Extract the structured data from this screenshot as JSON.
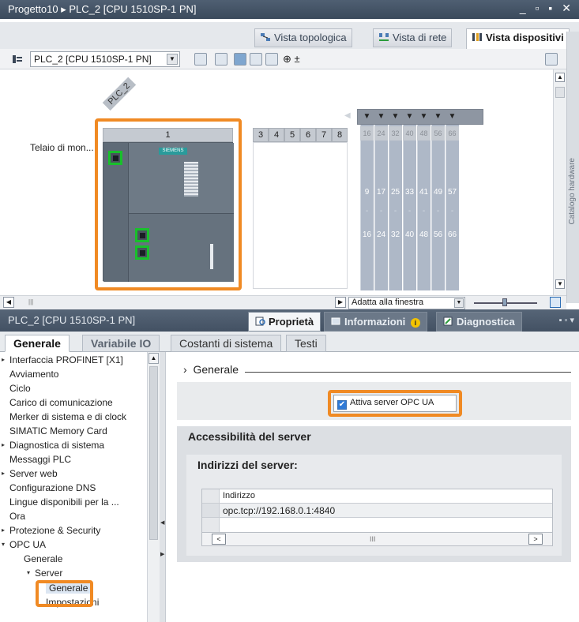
{
  "window": {
    "title": "Progetto10 ▸ PLC_2 [CPU 1510SP-1 PN]",
    "controls": "_ ▫ ▪ ✕"
  },
  "view_tabs": [
    {
      "label": "Vista topologica",
      "active": false
    },
    {
      "label": "Vista di rete",
      "active": false
    },
    {
      "label": "Vista dispositivi",
      "active": true
    }
  ],
  "toolbar": {
    "device_selector": "PLC_2 [CPU 1510SP-1 PN]",
    "zoom_plus": "⊕ ±"
  },
  "canvas": {
    "plc_tag": "PLC_2",
    "rack_label": "Telaio di mon...",
    "slots": [
      "1",
      "3",
      "4",
      "5",
      "6",
      "7",
      "8"
    ],
    "io_headers": [
      "16",
      "24",
      "32",
      "40",
      "48",
      "56",
      "66"
    ],
    "io_top": [
      "9",
      "17",
      "25",
      "33",
      "41",
      "49",
      "57"
    ],
    "io_bottom": [
      "16",
      "24",
      "32",
      "40",
      "48",
      "56",
      "66"
    ],
    "io_dash": "-",
    "brand": "SIEMENS",
    "side_panel_label": "Catalogo hardware",
    "zoom_select": "Adatta alla finestra"
  },
  "inspector": {
    "device_name": "PLC_2 [CPU 1510SP-1 PN]",
    "tabs": [
      {
        "label": "Proprietà",
        "active": true
      },
      {
        "label": "Informazioni",
        "active": false
      },
      {
        "label": "Diagnostica",
        "active": false
      }
    ],
    "subtabs": [
      {
        "label": "Generale",
        "active": true
      },
      {
        "label": "Variabile IO",
        "active": false
      },
      {
        "label": "Costanti di sistema",
        "active": false
      },
      {
        "label": "Testi",
        "active": false
      }
    ]
  },
  "nav": {
    "items": [
      {
        "label": "Interfaccia PROFINET [X1]",
        "twisty": "▸"
      },
      {
        "label": "Avviamento",
        "twisty": ""
      },
      {
        "label": "Ciclo",
        "twisty": ""
      },
      {
        "label": "Carico di comunicazione",
        "twisty": ""
      },
      {
        "label": "Merker di sistema e di clock",
        "twisty": ""
      },
      {
        "label": "SIMATIC Memory Card",
        "twisty": ""
      },
      {
        "label": "Diagnostica di sistema",
        "twisty": "▸"
      },
      {
        "label": "Messaggi PLC",
        "twisty": ""
      },
      {
        "label": "Server web",
        "twisty": "▸"
      },
      {
        "label": "Configurazione DNS",
        "twisty": ""
      },
      {
        "label": "Lingue disponibili per la ...",
        "twisty": ""
      },
      {
        "label": "Ora",
        "twisty": ""
      },
      {
        "label": "Protezione & Security",
        "twisty": "▸"
      },
      {
        "label": "OPC UA",
        "twisty": "▾"
      },
      {
        "label": "Generale",
        "twisty": ""
      },
      {
        "label": "Server",
        "twisty": "▾"
      },
      {
        "label": "Generale",
        "twisty": ""
      },
      {
        "label": "Impostazioni",
        "twisty": ""
      }
    ]
  },
  "content": {
    "breadcrumb_arrow": "›",
    "section_title": "Generale",
    "checkbox_label": "Attiva server OPC UA",
    "checkbox_checked": true,
    "check_glyph": "✔",
    "server_access_title": "Accessibilità del server",
    "server_addresses_title": "Indirizzi del server:",
    "table_header": "Indirizzo",
    "table_rows": [
      "opc.tcp://192.168.0.1:4840"
    ],
    "scroll_left": "<",
    "scroll_right": ">",
    "scroll_grip": "III"
  },
  "colors": {
    "highlight": "#f08a24",
    "port_highlight": "#18c02b",
    "title_bar": "#3b4a5c"
  }
}
